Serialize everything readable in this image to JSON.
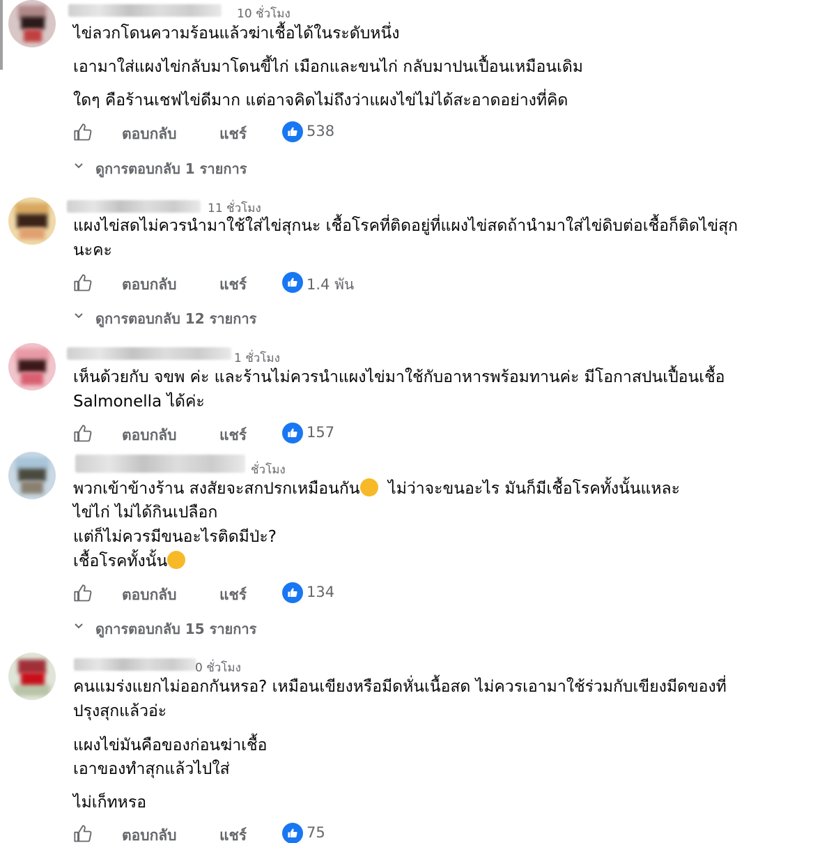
{
  "labels": {
    "reply": "ตอบกลับ",
    "share": "แชร์"
  },
  "colors": {
    "accent": "#1877f2",
    "muted": "#65676b",
    "text": "#050505"
  },
  "comments": [
    {
      "time": "10 ชั่วโมง",
      "lines": [
        "ไข่ลวกโดนความร้อนแล้วฆ่าเชื้อได้ในระดับหนึ่ง",
        "เอามาใส่แผงไข่กลับมาโดนขี้ไก่ เมือกและขนไก่ กลับมาปนเปื้อนเหมือนเดิม",
        "ใดๆ คือร้านเชฟไข่ดีมาก แต่อาจคิดไม่ถึงว่าแผงไข่ไม่ได้สะอาดอย่างที่คิด"
      ],
      "reactions": "538",
      "view_replies": "ดูการตอบกลับ 1 รายการ"
    },
    {
      "time": "11 ชั่วโมง",
      "lines": [
        "แผงไข่สดไม่ควรนำมาใช้ใส่ไข่สุกนะ เชื้อโรคที่ติดอยู่ที่แผงไข่สดถ้านำมาใส่ไข่ดิบต่อเชื้อก็ติดไข่สุก",
        "นะคะ"
      ],
      "reactions": "1.4 พัน",
      "view_replies": "ดูการตอบกลับ 12 รายการ"
    },
    {
      "time": "1 ชั่วโมง",
      "lines": [
        "เห็นด้วยกับ จขพ ค่ะ และร้านไม่ควรนำแผงไข่มาใช้กับอาหารพร้อมทานค่ะ มีโอกาสปนเปื้อนเชื้อ",
        "Salmonella ได้ค่ะ"
      ],
      "reactions": "157"
    },
    {
      "time": "ชั่วโมง",
      "lines": [
        "พวกเข้าข้างร้าน สงสัยจะสกปรกเหมือนกัน",
        "ไม่ว่าจะขนอะไร มันก็มีเชื้อโรคทั้งนั้นแหละ",
        "ไข่ไก่ ไม่ได้กินเปลือก",
        "แต่ก็ไม่ควรมีขนอะไรติดมีป่ะ?",
        "เชื้อโรคทั้งนั้น"
      ],
      "reactions": "134",
      "view_replies": "ดูการตอบกลับ 15 รายการ"
    },
    {
      "time": "0 ชั่วโมง",
      "lines": [
        "คนแมร่งแยกไม่ออกกันหรอ? เหมือนเขียงหรือมีดหั่นเนื้อสด ไม่ควรเอามาใช้ร่วมกับเขียงมีดของที่",
        "ปรุงสุกแล้วอ่ะ",
        "แผงไข่มันคือของก่อนฆ่าเชื้อ",
        "เอาของทำสุกแล้วไปใส่",
        "ไม่เก็ทหรอ"
      ],
      "reactions": "75"
    }
  ]
}
